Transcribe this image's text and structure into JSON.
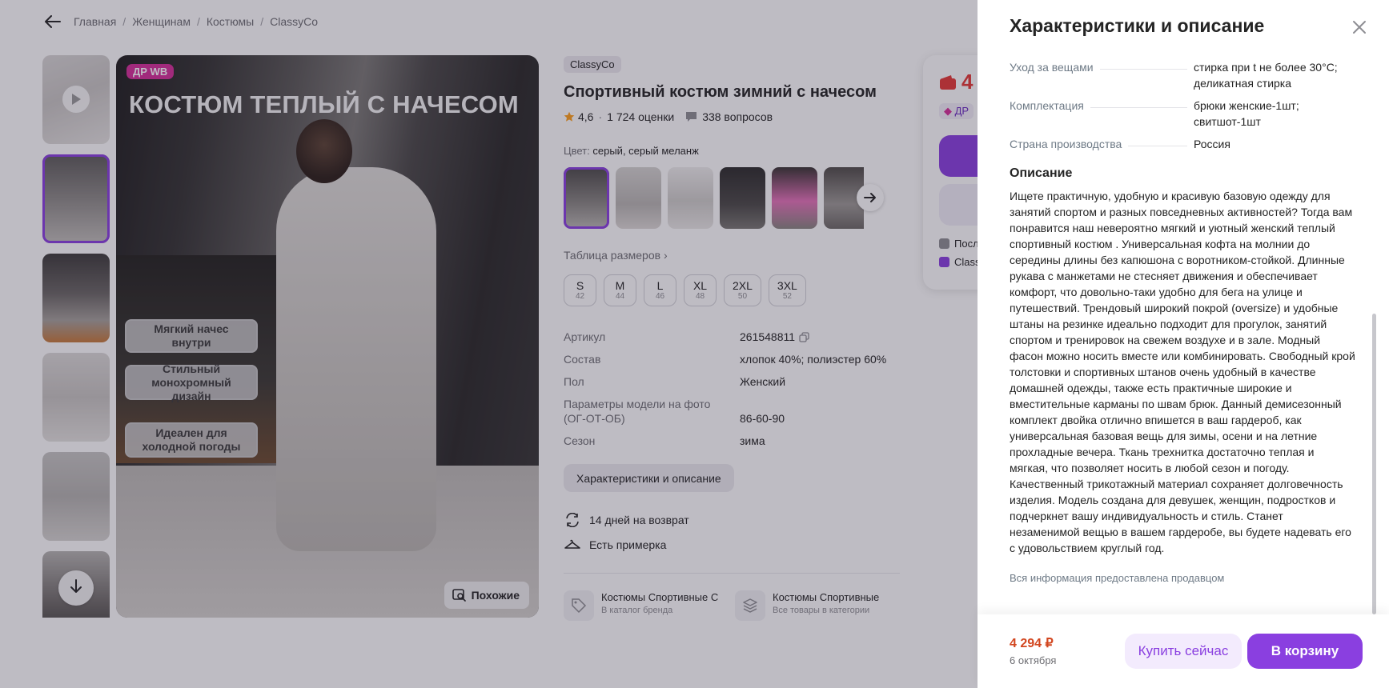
{
  "breadcrumbs": [
    "Главная",
    "Женщинам",
    "Костюмы",
    "ClassyCo"
  ],
  "gallery": {
    "badge": "ДР WB",
    "headline": "КОСТЮМ ТЕПЛЫЙ С НАЧЕСОМ",
    "features": [
      "Мягкий начес внутри",
      "Стильный монохромный дизайн",
      "Идеален для холодной погоды"
    ],
    "similar_label": "Похожие"
  },
  "product": {
    "brand": "ClassyCo",
    "title": "Спортивный костюм зимний с начесом",
    "rating": "4,6",
    "reviews": "1 724 оценки",
    "questions": "338 вопросов",
    "color_label": "Цвет:",
    "color_value": "серый, серый меланж",
    "size_table_label": "Таблица размеров",
    "sizes": [
      {
        "label": "S",
        "ru": "42"
      },
      {
        "label": "M",
        "ru": "44"
      },
      {
        "label": "L",
        "ru": "46"
      },
      {
        "label": "XL",
        "ru": "48"
      },
      {
        "label": "2XL",
        "ru": "50"
      },
      {
        "label": "3XL",
        "ru": "52"
      }
    ],
    "params": [
      {
        "key": "Артикул",
        "value": "261548811"
      },
      {
        "key": "Состав",
        "value": "хлопок 40%; полиэстер 60%"
      },
      {
        "key": "Пол",
        "value": "Женский"
      },
      {
        "key": "Параметры модели на фото (ОГ-ОТ-ОБ)",
        "value": "86-60-90"
      },
      {
        "key": "Сезон",
        "value": "зима"
      }
    ],
    "chars_button": "Характеристики и описание",
    "return_label": "14 дней на возврат",
    "fitting_label": "Есть примерка",
    "categories": [
      {
        "title": "Костюмы Спортивные С",
        "sub": "В каталог бренда"
      },
      {
        "title": "Костюмы Спортивные",
        "sub": "Все товары в категории"
      }
    ]
  },
  "buy_card": {
    "price_partial": "4",
    "dr_partial": "ДР",
    "line1": "Посл",
    "line2": "Class"
  },
  "drawer": {
    "title": "Характеристики и описание",
    "specs": [
      {
        "key": "Уход за вещами",
        "value": "стирка при t не более 30°C; деликатная стирка"
      },
      {
        "key": "Комплектация",
        "value": "брюки женские-1шт; свитшот-1шт"
      },
      {
        "key": "Страна производства",
        "value": "Россия"
      }
    ],
    "description_heading": "Описание",
    "description": "Ищете практичную, удобную и красивую базовую одежду для занятий спортом и разных повседневных активностей? Тогда вам понравится наш невероятно мягкий и уютный женский теплый спортивный костюм . Универсальная кофта на молнии до середины длины без капюшона с воротником-стойкой. Длинные рукава с манжетами не стесняет движения и обеспечивает комфорт, что довольно-таки удобно для бега на улице и путешествий. Трендовый широкий покрой (oversize) и удобные штаны на резинке идеально подходит для прогулок, занятий спортом и тренировок на свежем воздухе и в зале. Модный фасон можно носить вместе или комбинировать. Свободный крой толстовки и спортивных штанов очень удобный в качестве домашней одежды, также есть практичные широкие и вместительные карманы по швам брюк. Данный демисезонный комплект двойка отлично впишется в ваш гардероб, как универсальная базовая вещь для зимы, осени и на летние прохладные вечера. Ткань трехнитка достаточно теплая и мягкая, что позволяет носить в любой сезон и погоду. Качественный трикотажный материал сохраняет долговечность изделия. Модель создана для девушек, женщин, подростков и подчеркнет вашу индивидуальность и стиль. Станет незаменимой вещью в вашем гардеробе, вы будете надевать его с удовольствием круглый год.",
    "seller_note": "Вся информация предоставлена продавцом",
    "footer": {
      "price": "4 294 ₽",
      "delivery_date": "6 октября",
      "buy_now": "Купить сейчас",
      "add_to_cart": "В корзину"
    }
  },
  "colors": {
    "accent": "#8a3fe0",
    "price_red": "#d2461f",
    "badge_pink": "#d62f9a",
    "overlay": "rgba(40,34,56,0.30)"
  },
  "icons": [
    "back-arrow-icon",
    "play-icon",
    "arrow-down-icon",
    "search-similar-icon",
    "star-icon",
    "question-icon",
    "chevron-right-icon",
    "copy-icon",
    "return-icon",
    "hanger-icon",
    "tag-icon",
    "layers-icon",
    "close-icon"
  ]
}
